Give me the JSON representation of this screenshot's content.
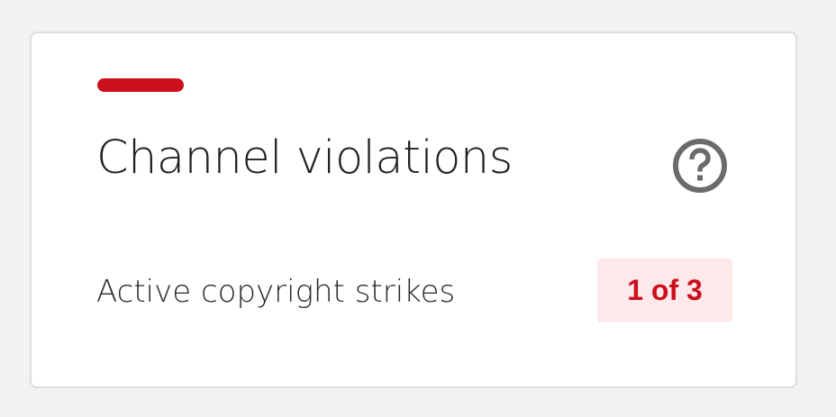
{
  "card": {
    "title": "Channel violations",
    "help_icon": "help-circle-icon",
    "rows": [
      {
        "label": "Active copyright strikes",
        "value": "1 of 3"
      }
    ]
  },
  "colors": {
    "accent": "#cc0f1c",
    "badge_bg": "#fde8ea",
    "icon": "#6b6b6b"
  }
}
